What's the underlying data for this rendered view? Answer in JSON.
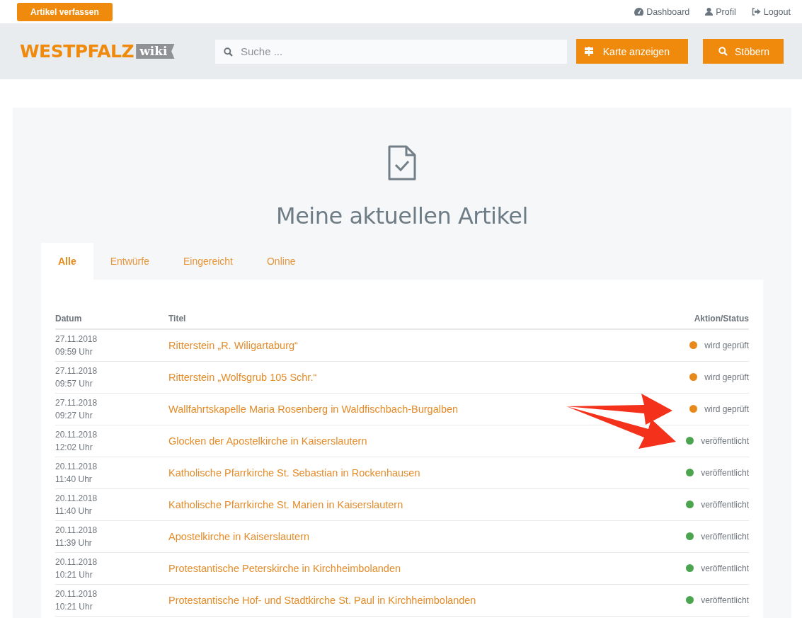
{
  "topbar": {
    "write_button": "Artikel verfassen",
    "links": [
      {
        "kind": "dashboard",
        "label": "Dashboard"
      },
      {
        "kind": "profile",
        "label": "Profil"
      },
      {
        "kind": "logout",
        "label": "Logout"
      }
    ]
  },
  "header": {
    "logo": {
      "main": "WESTPFALZ",
      "badge": "wiki"
    },
    "search": {
      "placeholder": "Suche ..."
    },
    "buttons": [
      {
        "kind": "map",
        "label": "Karte anzeigen"
      },
      {
        "kind": "search",
        "label": "Stöbern"
      }
    ]
  },
  "page_title": "Meine aktuellen Artikel",
  "tabs": [
    {
      "label": "Alle",
      "selected": true
    },
    {
      "label": "Entwürfe",
      "selected": false
    },
    {
      "label": "Eingereicht",
      "selected": false
    },
    {
      "label": "Online",
      "selected": false
    }
  ],
  "table": {
    "columns": [
      "Datum",
      "Titel",
      "Aktion/Status"
    ],
    "rows": [
      {
        "date": "27.11.2018",
        "time": "09:59 Uhr",
        "title": "Ritterstein „R. Wiligartaburg“",
        "status": "wird geprüft",
        "color": "#e8891b"
      },
      {
        "date": "27.11.2018",
        "time": "09:57 Uhr",
        "title": "Ritterstein „Wolfsgrub 105 Schr.“",
        "status": "wird geprüft",
        "color": "#e8891b"
      },
      {
        "date": "27.11.2018",
        "time": "09:27 Uhr",
        "title": "Wallfahrtskapelle Maria Rosenberg in Waldfischbach-Burgalben",
        "status": "wird geprüft",
        "color": "#e8891b"
      },
      {
        "date": "20.11.2018",
        "time": "12:02 Uhr",
        "title": "Glocken der Apostelkirche in Kaiserslautern",
        "status": "veröffentlicht",
        "color": "#4ba54e"
      },
      {
        "date": "20.11.2018",
        "time": "11:40 Uhr",
        "title": "Katholische Pfarrkirche St. Sebastian in Rockenhausen",
        "status": "veröffentlicht",
        "color": "#4ba54e"
      },
      {
        "date": "20.11.2018",
        "time": "11:40 Uhr",
        "title": "Katholische Pfarrkirche St. Marien in Kaiserslautern",
        "status": "veröffentlicht",
        "color": "#4ba54e"
      },
      {
        "date": "20.11.2018",
        "time": "11:39 Uhr",
        "title": "Apostelkirche in Kaiserslautern",
        "status": "veröffentlicht",
        "color": "#4ba54e"
      },
      {
        "date": "20.11.2018",
        "time": "10:21 Uhr",
        "title": "Protestantische Peterskirche in Kirchheimbolanden",
        "status": "veröffentlicht",
        "color": "#4ba54e"
      },
      {
        "date": "20.11.2018",
        "time": "10:21 Uhr",
        "title": "Protestantische Hof- und Stadtkirche St. Paul in Kirchheimbolanden",
        "status": "veröffentlicht",
        "color": "#4ba54e"
      }
    ]
  }
}
